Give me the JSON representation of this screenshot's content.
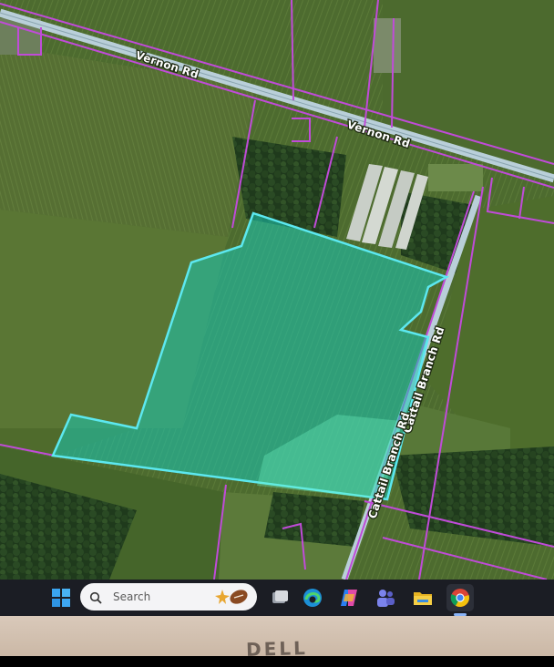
{
  "map": {
    "roads": {
      "vernon_rd_west": "Vernon Rd",
      "vernon_rd_east": "Vernon Rd",
      "cattail_branch_rd_north": "Cattail Branch Rd",
      "cattail_branch_rd_south": "Cattail Branch Rd"
    },
    "colors": {
      "parcel_lines": "#c04bd8",
      "selected_parcel_outline": "#5ce8f0",
      "selected_parcel_fill": "#19c9b5",
      "road": "#b9cfd9"
    }
  },
  "taskbar": {
    "search_placeholder": "Search",
    "apps": [
      {
        "name": "start-icon"
      },
      {
        "name": "task-view-icon"
      },
      {
        "name": "edge-icon"
      },
      {
        "name": "copilot-icon"
      },
      {
        "name": "teams-icon"
      },
      {
        "name": "file-explorer-icon"
      },
      {
        "name": "chrome-icon"
      }
    ]
  },
  "hardware": {
    "brand": "DELL"
  }
}
